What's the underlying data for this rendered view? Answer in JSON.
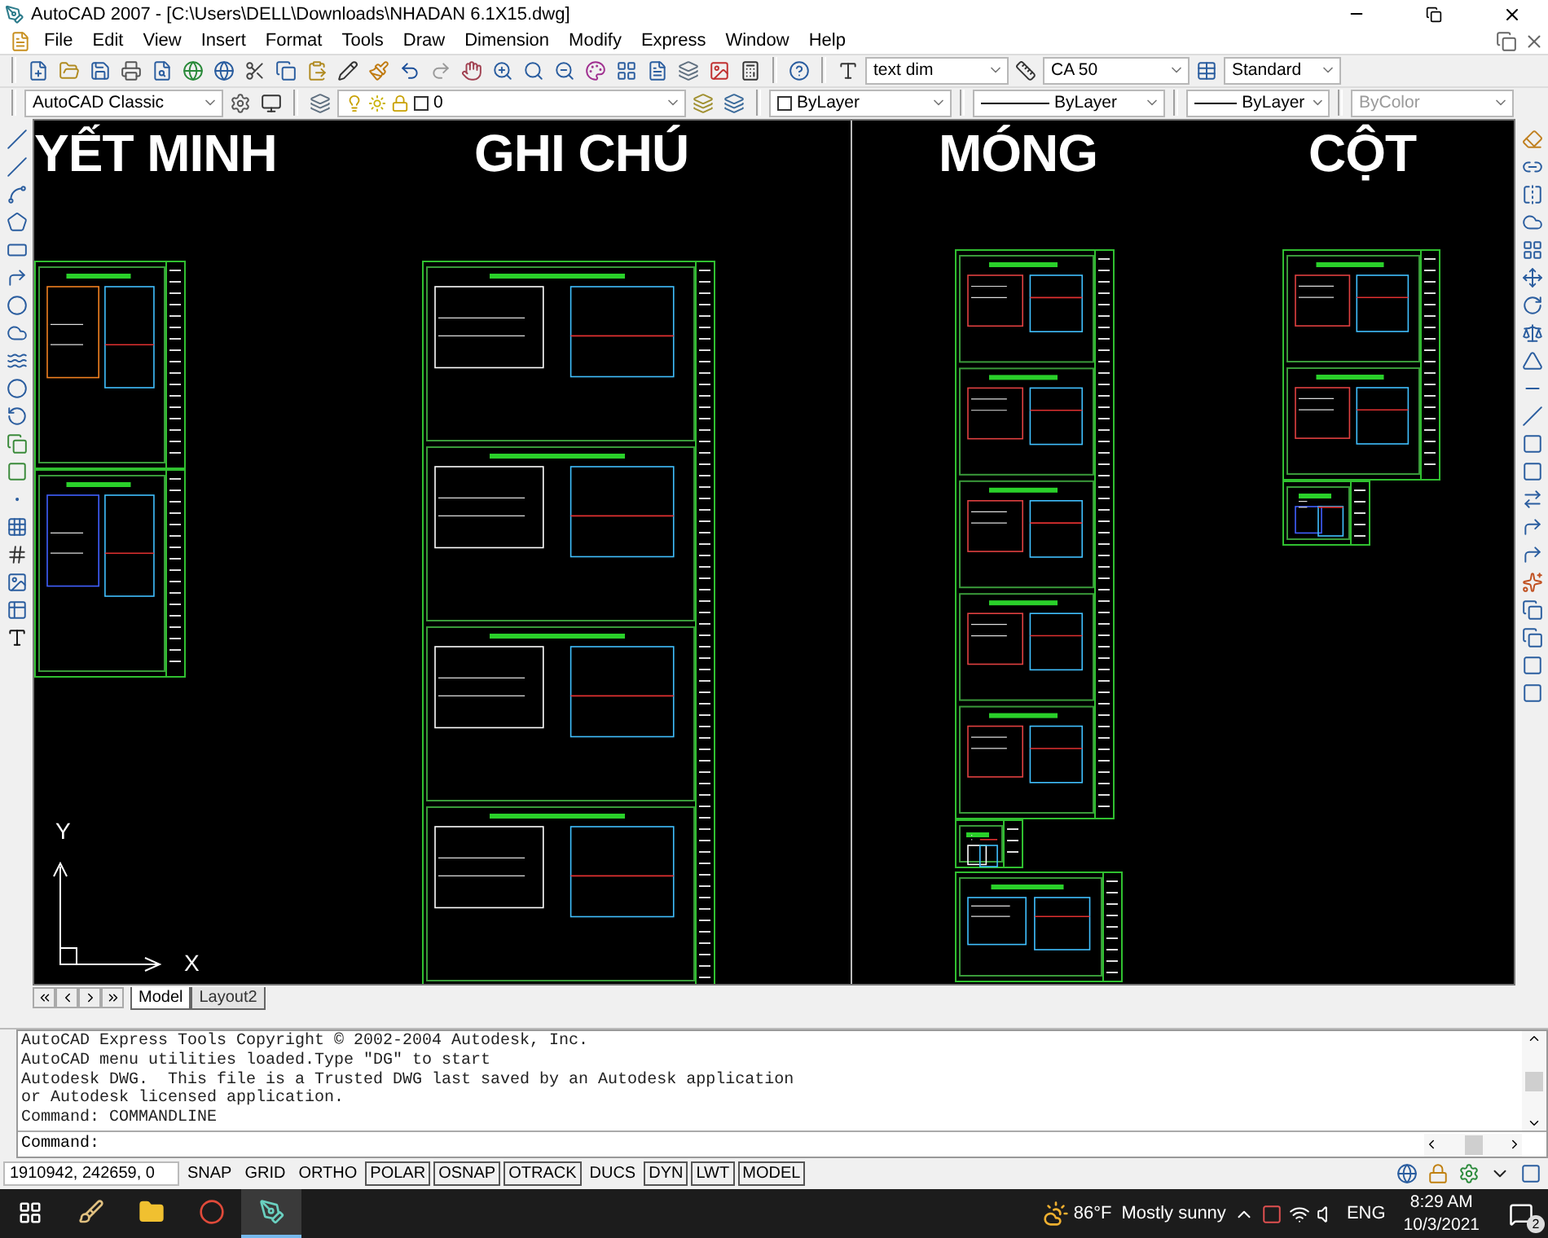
{
  "window": {
    "title": "AutoCAD 2007 - [C:\\Users\\DELL\\Downloads\\NHADAN 6.1X15.dwg]"
  },
  "menu": [
    "File",
    "Edit",
    "View",
    "Insert",
    "Format",
    "Tools",
    "Draw",
    "Dimension",
    "Modify",
    "Express",
    "Window",
    "Help"
  ],
  "styles_toolbar": [
    {
      "kind": "text",
      "value": "text dim",
      "disabled": false
    },
    {
      "kind": "dim",
      "value": "CA 50",
      "disabled": false
    },
    {
      "kind": "table",
      "value": "Standard",
      "disabled": false
    }
  ],
  "workspace": {
    "value": "AutoCAD Classic",
    "disabled": false
  },
  "layer": {
    "value": "0",
    "disabled": false
  },
  "properties_toolbar": [
    {
      "kind": "swatch",
      "value": "ByLayer",
      "disabled": false
    },
    {
      "kind": "line",
      "value": "ByLayer",
      "disabled": false
    },
    {
      "kind": "short-line",
      "value": "ByLayer",
      "disabled": false
    },
    {
      "kind": "plain",
      "value": "ByColor",
      "disabled": true
    }
  ],
  "drawing": {
    "headings": [
      "YẾT MINH",
      "GHI CHÚ",
      "MÓNG",
      "CỘT"
    ],
    "axis_labels": [
      "Y",
      "X"
    ]
  },
  "layout_tabs": [
    {
      "label": "Model",
      "selected": true
    },
    {
      "label": "Layout2",
      "selected": false
    }
  ],
  "command": {
    "history": [
      "AutoCAD Express Tools Copyright © 2002-2004 Autodesk, Inc.",
      "AutoCAD menu utilities loaded.Type \"DG\" to start",
      "Autodesk DWG.  This file is a Trusted DWG last saved by an Autodesk application",
      "or Autodesk licensed application.",
      "Command: COMMANDLINE"
    ],
    "prompt": "Command:"
  },
  "status_bar": {
    "coordinates": "1910942, 242659, 0",
    "toggles": [
      {
        "label": "SNAP",
        "on": false
      },
      {
        "label": "GRID",
        "on": false
      },
      {
        "label": "ORTHO",
        "on": false
      },
      {
        "label": "POLAR",
        "on": true
      },
      {
        "label": "OSNAP",
        "on": true
      },
      {
        "label": "OTRACK",
        "on": true
      },
      {
        "label": "DUCS",
        "on": false
      },
      {
        "label": "DYN",
        "on": true
      },
      {
        "label": "LWT",
        "on": true
      },
      {
        "label": "MODEL",
        "on": true
      }
    ]
  },
  "taskbar": {
    "weather": {
      "temperature": "86°F",
      "condition": "Mostly sunny"
    },
    "language": "ENG",
    "time": "8:29 AM",
    "date": "10/3/2021",
    "notifications": "2"
  }
}
